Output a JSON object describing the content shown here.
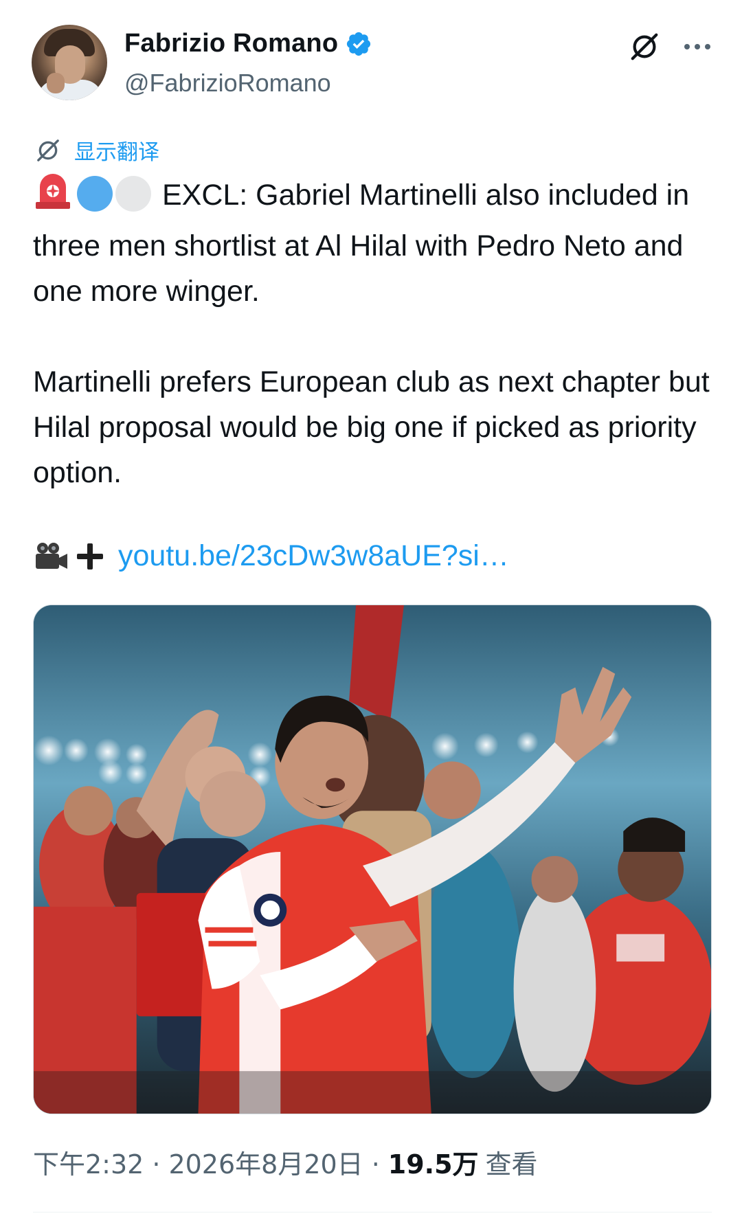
{
  "author": {
    "name": "Fabrizio Romano",
    "handle": "@FabrizioRomano",
    "verified": true
  },
  "actions": {
    "grok_icon": "grok-icon",
    "more_icon": "more-icon"
  },
  "translate": {
    "label": "显示翻译"
  },
  "tweet": {
    "paragraph1": "EXCL: Gabriel Martinelli also included in three men shortlist at Al Hilal with Pedro Neto and one more winger.",
    "paragraph2": "Martinelli prefers European club as next chapter but Hilal proposal would be big one if picked as priority option.",
    "link_text": "youtu.be/23cDw3w8aUE?si…",
    "emojis": [
      "rotating-light",
      "blue-circle",
      "white-circle"
    ],
    "link_emojis": [
      "movie-camera",
      "plus"
    ]
  },
  "meta": {
    "time": "下午2:32",
    "date": "2026年8月20日",
    "views_count": "19.5万",
    "views_label": "查看"
  },
  "colors": {
    "accent": "#1d9bf0",
    "text": "#0f1419",
    "secondary": "#536471",
    "verified": "#1d9bf0"
  }
}
